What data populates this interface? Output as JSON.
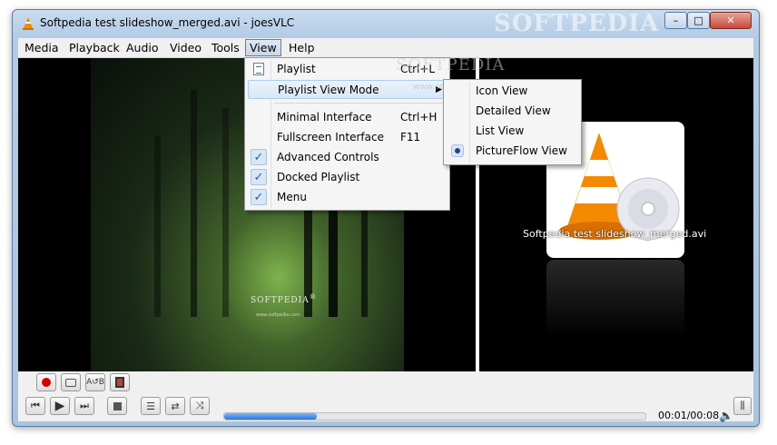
{
  "window": {
    "title": "Softpedia test slideshow_merged.avi - joesVLC",
    "watermark": "SOFTPEDIA",
    "controls": {
      "minimize": "–",
      "maximize": "□",
      "close": "✕"
    }
  },
  "menubar": {
    "items": [
      {
        "label": "Media"
      },
      {
        "label": "Playback"
      },
      {
        "label": "Audio"
      },
      {
        "label": "Video"
      },
      {
        "label": "Tools"
      },
      {
        "label": "View"
      },
      {
        "label": "Help"
      }
    ],
    "active": "View"
  },
  "view_menu": {
    "items": [
      {
        "label": "Playlist",
        "shortcut": "Ctrl+L",
        "checked": false,
        "icon": "playlist-icon"
      },
      {
        "label": "Playlist View Mode",
        "shortcut": "",
        "checked": false,
        "submenu": true,
        "highlighted": true
      },
      {
        "label": "Minimal Interface",
        "shortcut": "Ctrl+H",
        "checked": false
      },
      {
        "label": "Fullscreen Interface",
        "shortcut": "F11",
        "checked": false
      },
      {
        "label": "Advanced Controls",
        "shortcut": "",
        "checked": true
      },
      {
        "label": "Docked Playlist",
        "shortcut": "",
        "checked": true
      },
      {
        "label": "Menu",
        "shortcut": "",
        "checked": true
      }
    ]
  },
  "view_mode_submenu": {
    "items": [
      {
        "label": "Icon View",
        "selected": false
      },
      {
        "label": "Detailed View",
        "selected": false
      },
      {
        "label": "List View",
        "selected": false
      },
      {
        "label": "PictureFlow View",
        "selected": true
      }
    ]
  },
  "video": {
    "watermark": "SOFTPEDIA",
    "watermark_sup": "®",
    "watermark_url": "www.softpedia.com",
    "menu_watermark": "SOFTPEDIA",
    "menu_watermark_url": "www.softpedia.com"
  },
  "pictureflow": {
    "caption": "Softpedia test slideshow_merged.avi"
  },
  "controls": {
    "time": "00:01/00:08",
    "progress": 0.22,
    "accent": "#2a78d6"
  }
}
